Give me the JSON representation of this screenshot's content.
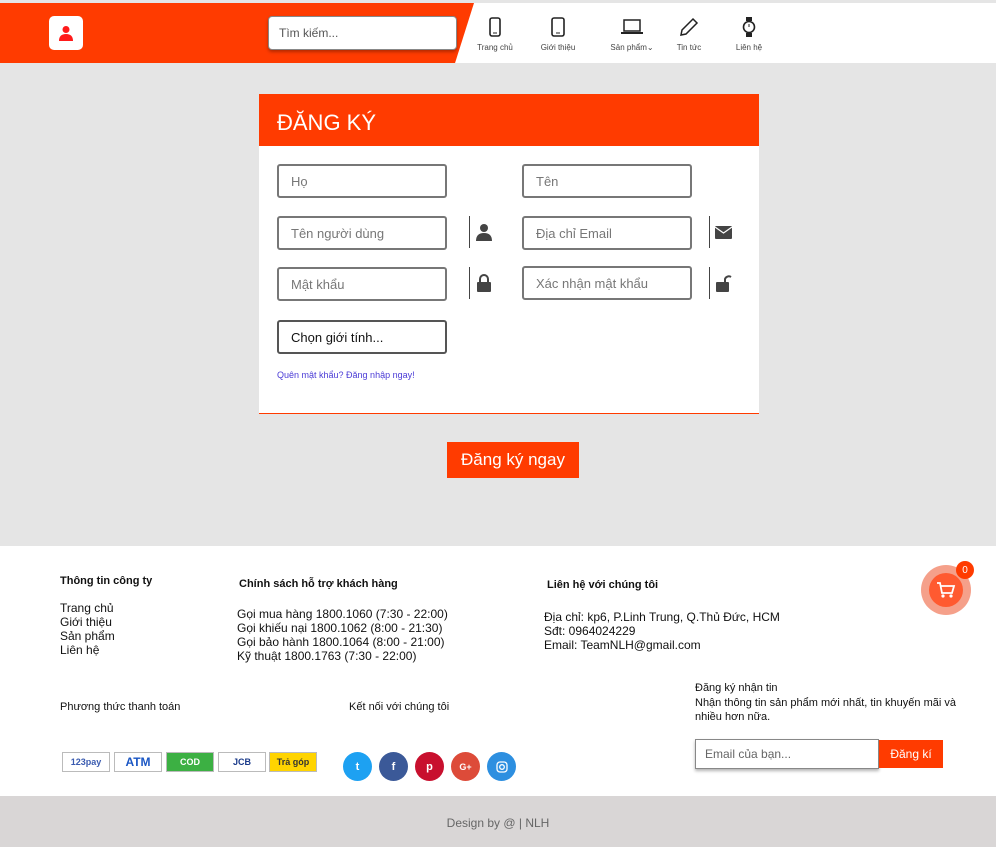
{
  "header": {
    "search_placeholder": "Tìm kiếm...",
    "nav": [
      {
        "label": "Trang chủ",
        "icon": "mobile-icon"
      },
      {
        "label": "Giới thiệu",
        "icon": "tablet-icon"
      },
      {
        "label": "Sản phẩm",
        "icon": "laptop-icon"
      },
      {
        "label": "Tin tức",
        "icon": "pen-icon"
      },
      {
        "label": "Liên hệ",
        "icon": "watch-icon"
      }
    ],
    "brand_color": "#ff3b00"
  },
  "form": {
    "title": "ĐĂNG KÝ",
    "last_name_placeholder": "Họ",
    "first_name_placeholder": "Tên",
    "username_placeholder": "Tên người dùng",
    "email_placeholder": "Địa chỉ Email",
    "password_placeholder": "Mật khẩu",
    "confirm_placeholder": "Xác nhận mật khẩu",
    "gender_select": "Chọn giới tính...",
    "forgot_link": "Quên mật khẩu? Đăng nhập ngay!",
    "submit_label": "Đăng ký ngay"
  },
  "footer": {
    "company_title": "Thông tin công ty",
    "company_links": [
      "Trang chủ",
      "Giới thiệu",
      "Sản phẩm",
      "Liên hệ"
    ],
    "support_title": "Chính sách hỗ trợ khách hàng",
    "support_lines": [
      "Gọi mua hàng 1800.1060 (7:30 - 22:00)",
      "Gọi khiếu nại 1800.1062 (8:00 - 21:30)",
      "Gọi bảo hành 1800.1064 (8:00 - 21:00)",
      "Kỹ thuật 1800.1763 (7:30 - 22:00)"
    ],
    "contact_title": "Liên hệ với chúng tôi",
    "contact_lines": [
      "Địa chỉ: kp6, P.Linh Trung, Q.Thủ Đức, HCM",
      "Sđt: 0964024229",
      "Email: TeamNLH@gmail.com"
    ],
    "payment_title": "Phương thức thanh toán",
    "payment_methods": [
      "123pay",
      "ATM",
      "COD",
      "JCB",
      "Trả góp"
    ],
    "social_title": "Kết nối với chúng tôi",
    "socials": [
      "twitter-icon",
      "facebook-icon",
      "pinterest-icon",
      "google-plus-icon",
      "instagram-icon"
    ],
    "newsletter_title": "Đăng ký nhận tin",
    "newsletter_desc": "Nhận thông tin sản phẩm mới nhất, tin khuyến mãi và nhiều hơn nữa.",
    "newsletter_placeholder": "Email của bạn...",
    "newsletter_button": "Đăng kí"
  },
  "cart": {
    "count": "0"
  },
  "credit": "Design by @ | NLH"
}
